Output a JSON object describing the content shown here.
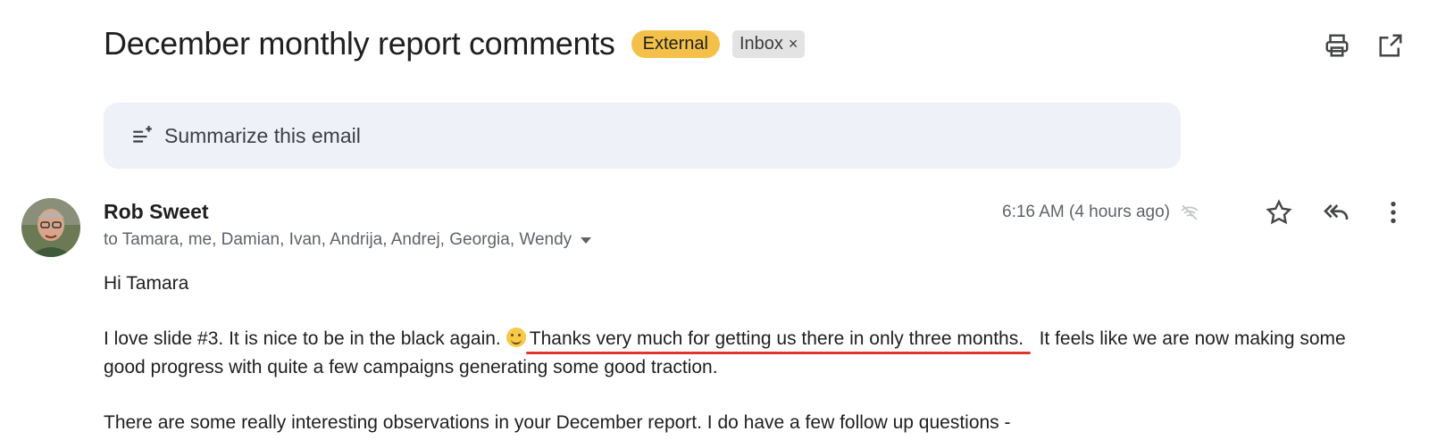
{
  "email": {
    "subject": "December monthly report comments",
    "labels": {
      "external": "External",
      "inbox": "Inbox",
      "inbox_remove": "×"
    },
    "summarize_label": "Summarize this email",
    "sender": "Rob Sweet",
    "recipients": "to Tamara, me, Damian, Ivan, Andrija, Andrej, Georgia, Wendy",
    "time": "6:16 AM (4 hours ago)",
    "body": {
      "greeting": "Hi Tamara",
      "p1_a": "I love slide #3.  It is nice to be in the black again.",
      "p1_highlight": "Thanks very much for getting us there in only three months.",
      "p1_b": "It feels like we are now making some good progress with quite a few campaigns generating some good traction.",
      "p2": "There are some really interesting observations in your December report.  I do have a few follow up questions -"
    }
  },
  "colors": {
    "external_badge": "#f3c14a",
    "summarize_bg": "#eef1f7",
    "underline": "#e0362c"
  },
  "icons": [
    "print-icon",
    "open-in-new-window-icon",
    "summarize-sparkle-icon",
    "signal-icon",
    "star-icon",
    "reply-all-icon",
    "more-vert-icon",
    "smile-emoji"
  ]
}
